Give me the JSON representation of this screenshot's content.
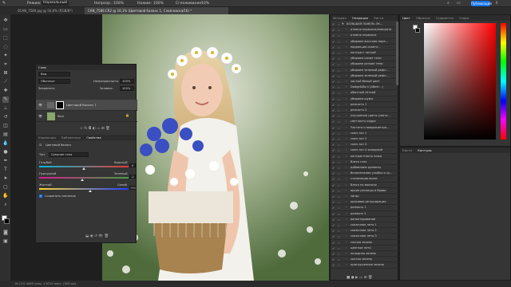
{
  "options_bar": {
    "mode_label": "Режим:",
    "mode_value": "Нормальный",
    "opacity_label": "Непрозр.:",
    "opacity_value": "100%",
    "flow_label": "Нажим:",
    "flow_value": "100%",
    "smoothing_label": "Сглаживание:",
    "smoothing_value": "10%",
    "publish_label": "Публикация"
  },
  "doc_tabs": [
    {
      "label": "0CAN_7589.jpg @ 50,6% (RGB/8*)",
      "active": false
    },
    {
      "label": "CAN_7589.CR2 @ 16,1% (Цветовой баланс 1, Слой-маска/16) *",
      "active": true
    }
  ],
  "status": "16,11%   4480 пикс. x 6720 пикс. (300 ppi)",
  "layers_panel": {
    "tab": "Слои",
    "filter": "Вид",
    "blend_mode": "Обычные",
    "opacity_label": "Непрозрачность:",
    "opacity_value": "100%",
    "lock_label": "Закрепить:",
    "fill_label": "Заливка:",
    "fill_value": "100%",
    "layers": [
      {
        "name": "Цветовой баланс 1",
        "selected": true
      },
      {
        "name": "Фон",
        "selected": false
      }
    ]
  },
  "properties_panel": {
    "tabs": [
      "Коррекция",
      "Библиотеки",
      "Свойства"
    ],
    "active_tab": "Свойства",
    "title": "Цветовой баланс",
    "tone_label": "Тон:",
    "tone_value": "Средние тона",
    "sliders": [
      {
        "left": "Голубой",
        "right": "Красный",
        "value": "0"
      },
      {
        "left": "Пурпурный",
        "right": "Зеленый",
        "value": "-2"
      },
      {
        "left": "Желтый",
        "right": "Синий",
        "value": "+15"
      }
    ],
    "preserve_label": "Сохранить свечение"
  },
  "actions_panel": {
    "tabs": [
      "История",
      "Операции",
      "Кисти"
    ],
    "active_tab": "Операции",
    "items": [
      {
        "label": "БОЛЬШАЯ ПАНЕЛЬ ЭК...",
        "level": 0
      },
      {
        "label": "отмена перекоса/поворота",
        "level": 1
      },
      {
        "label": "отмена перекоса",
        "level": 1
      },
      {
        "label": "убираем жесткие пере...",
        "level": 1
      },
      {
        "label": "коррекция осветл...",
        "level": 1
      },
      {
        "label": "контраст легкий",
        "level": 1
      },
      {
        "label": "убираем синие тени",
        "level": 1
      },
      {
        "label": "убираем резкие тени",
        "level": 1
      },
      {
        "label": "убираем зеленый рефл...",
        "level": 1
      },
      {
        "label": "убираем зеленый рефл...",
        "level": 1
      },
      {
        "label": "частый белый цвет",
        "level": 1
      },
      {
        "label": "Dodge&Burn (облег...)",
        "level": 1
      },
      {
        "label": "обычный чёткий",
        "level": 1
      },
      {
        "label": "убираем шумы",
        "level": 1
      },
      {
        "label": "резкость 1",
        "level": 1
      },
      {
        "label": "резкость 2",
        "level": 1
      },
      {
        "label": "улучшение цвета (свето...",
        "level": 1
      },
      {
        "label": "светлость кадра",
        "level": 1
      },
      {
        "label": "Частота и микроконтра...",
        "level": 1
      },
      {
        "label": "скин-тон 1",
        "level": 1
      },
      {
        "label": "скин-тон 2",
        "level": 1
      },
      {
        "label": "скин-тон 3",
        "level": 1
      },
      {
        "label": "скин-тон 4 холодный",
        "level": 1
      },
      {
        "label": "контрастность кожи",
        "level": 1
      },
      {
        "label": "блеск глаз",
        "level": 1
      },
      {
        "label": "добавляем румянец",
        "level": 1
      },
      {
        "label": "белоснежная улыбка и зу...",
        "level": 1
      },
      {
        "label": "стилизация волос",
        "level": 1
      },
      {
        "label": "блеск на волосах",
        "level": 1
      },
      {
        "label": "яркие ресницы и брови",
        "level": 1
      },
      {
        "label": "загар",
        "level": 1
      },
      {
        "label": "красивая ретуширация",
        "level": 1
      },
      {
        "label": "размыть 1",
        "level": 1
      },
      {
        "label": "размыть 2",
        "level": 1
      },
      {
        "label": "виньетирование",
        "level": 1
      },
      {
        "label": "сказочное лето 1",
        "level": 1
      },
      {
        "label": "сказочное лето 2",
        "level": 1
      },
      {
        "label": "сказочное лето 3",
        "level": 1
      },
      {
        "label": "сочная зелень",
        "level": 1
      },
      {
        "label": "цветное лето",
        "level": 1
      },
      {
        "label": "холодная зелень",
        "level": 1
      },
      {
        "label": "чистая зелень",
        "level": 1
      },
      {
        "label": "приглушенная зелень",
        "level": 1
      }
    ]
  },
  "color_panel": {
    "tabs": [
      "Цвет",
      "Образцы",
      "Градиенты",
      "Узоры"
    ],
    "active_tab": "Цвет"
  },
  "swatches_panel": {
    "tabs": [
      "Кисти",
      "Контуры"
    ],
    "active_tab": "Контуры"
  }
}
